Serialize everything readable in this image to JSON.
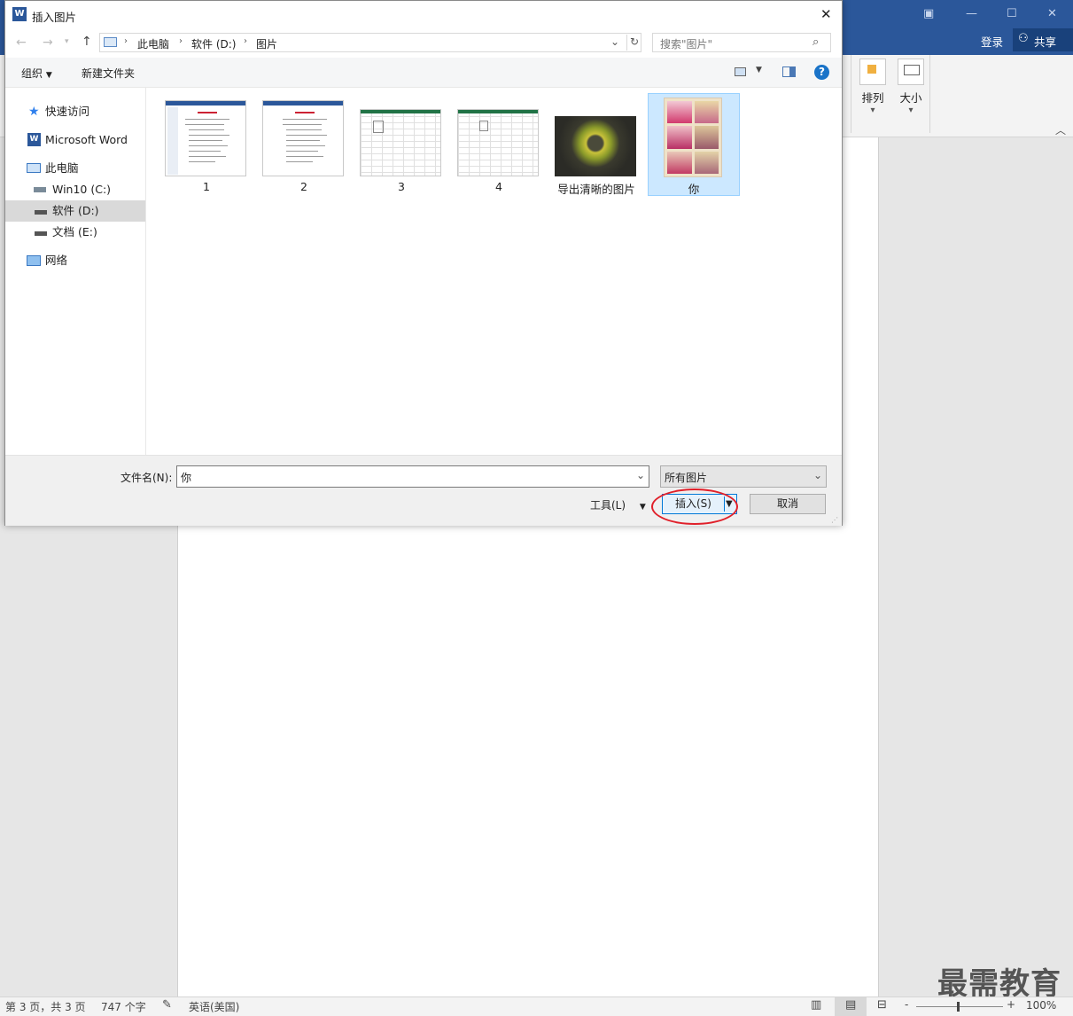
{
  "word": {
    "login": "登录",
    "share": "共享",
    "ribbon_arrange": "排列",
    "ribbon_size": "大小",
    "status": {
      "page": "第 3 页，共 3 页",
      "words": "747 个字",
      "language": "英语(美国)",
      "zoom": "100%",
      "zoom_minus": "-",
      "zoom_plus": "+"
    },
    "watermark": "最需教育"
  },
  "dialog": {
    "title": "插入图片",
    "close": "✕",
    "breadcrumb": [
      "此电脑",
      "软件 (D:)",
      "图片"
    ],
    "search_placeholder": "搜索\"图片\"",
    "toolbar": {
      "organize": "组织",
      "new_folder": "新建文件夹",
      "help": "?"
    },
    "nav": {
      "quick_access": "快速访问",
      "microsoft_word": "Microsoft Word",
      "this_pc": "此电脑",
      "drive_c": "Win10 (C:)",
      "drive_d": "软件 (D:)",
      "drive_e": "文档 (E:)",
      "network": "网络"
    },
    "files": [
      "1",
      "2",
      "3",
      "4",
      "导出清晰的图片",
      "你"
    ],
    "filename_label": "文件名(N):",
    "filename_value": "你",
    "filetype_value": "所有图片",
    "tools_label": "工具(L)",
    "insert_label": "插入(S)",
    "cancel_label": "取消"
  },
  "colors": {
    "word_blue": "#2b579a",
    "selection": "#cce8ff",
    "annotation_red": "#e0202a"
  }
}
